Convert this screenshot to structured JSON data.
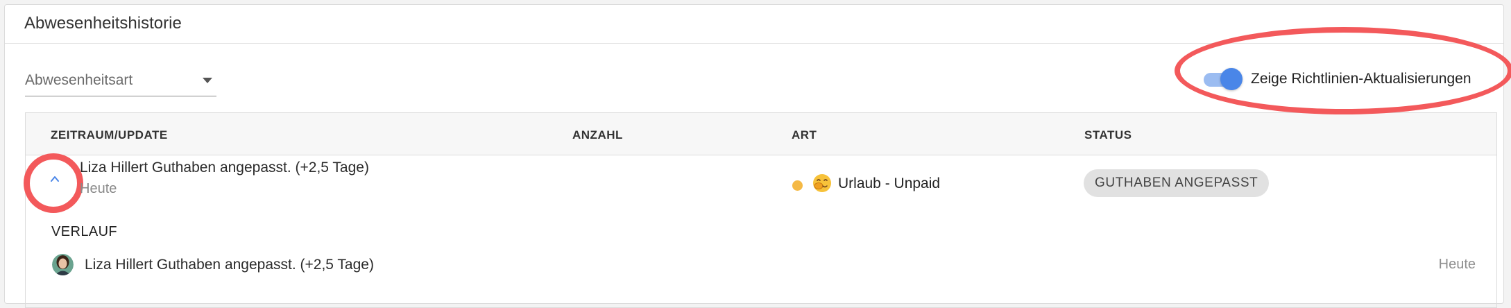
{
  "card": {
    "title": "Abwesenheitshistorie"
  },
  "filter": {
    "value": "Abwesenheitsart"
  },
  "toggle": {
    "label": "Zeige Richtlinien-Aktualisierungen",
    "checked": true,
    "accent": "#4a86e8"
  },
  "table": {
    "columns": [
      "ZEITRAUM/UPDATE",
      "ANZAHL",
      "ART",
      "STATUS"
    ],
    "row": {
      "title": "Liza Hillert Guthaben angepasst. (+2,5 Tage)",
      "subtitle": "Heute",
      "type_label": "Urlaub - Unpaid",
      "type_emoji": "face-with-hand-over-mouth",
      "status": "GUTHABEN ANGEPASST",
      "dot_color": "#f5b945"
    },
    "history": {
      "heading": "VERLAUF",
      "items": [
        {
          "text": "Liza Hillert Guthaben angepasst. (+2,5 Tage)",
          "date": "Heute"
        }
      ]
    }
  },
  "annotations": {
    "color": "#f3595b"
  }
}
